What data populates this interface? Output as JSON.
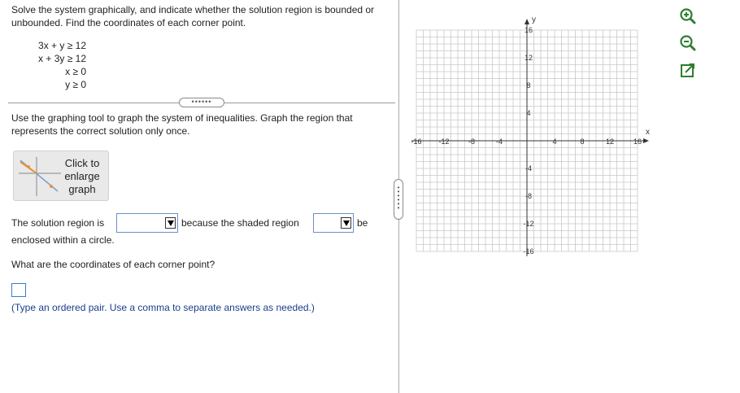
{
  "question": {
    "prompt": "Solve the system graphically, and indicate whether the solution region is bounded or unbounded. Find the coordinates of each corner point.",
    "inequalities": [
      "3x + y ≥ 12",
      "x + 3y ≥ 12",
      "x ≥ 0",
      "y ≥ 0"
    ],
    "separator_dots": "••••••",
    "instruction": "Use the graphing tool to graph the system of inequalities. Graph the region that represents the correct solution only once.",
    "enlarge_label": "Click to enlarge graph",
    "sentence_part1": "The solution region is",
    "sentence_part2": "because the shaded region",
    "sentence_part3": "be",
    "sentence_part4": "enclosed within a circle.",
    "corner_question": "What are the coordinates of each corner point?",
    "answer_value": "",
    "answer_hint": "(Type an ordered pair. Use a comma to separate answers as needed.)",
    "dropdown1_value": "",
    "dropdown2_value": ""
  },
  "graph": {
    "x_axis_label": "x",
    "y_axis_label": "y",
    "x_tick_labels": [
      "-16",
      "-12",
      "-8",
      "-4",
      "4",
      "8",
      "12",
      "16"
    ],
    "y_tick_labels": [
      "16",
      "12",
      "8",
      "4",
      "-4",
      "-8",
      "-12",
      "-16"
    ],
    "x_range": [
      -16,
      16
    ],
    "y_range": [
      -16,
      16
    ],
    "grid_step": 1,
    "grid": true
  },
  "tools": {
    "zoom_in": "zoom-in-icon",
    "zoom_out": "zoom-out-icon",
    "popout": "popout-icon"
  },
  "colors": {
    "accent": "#3a7bd5",
    "hint_text": "#1a3e8c",
    "tool_green": "#2e7d32"
  }
}
